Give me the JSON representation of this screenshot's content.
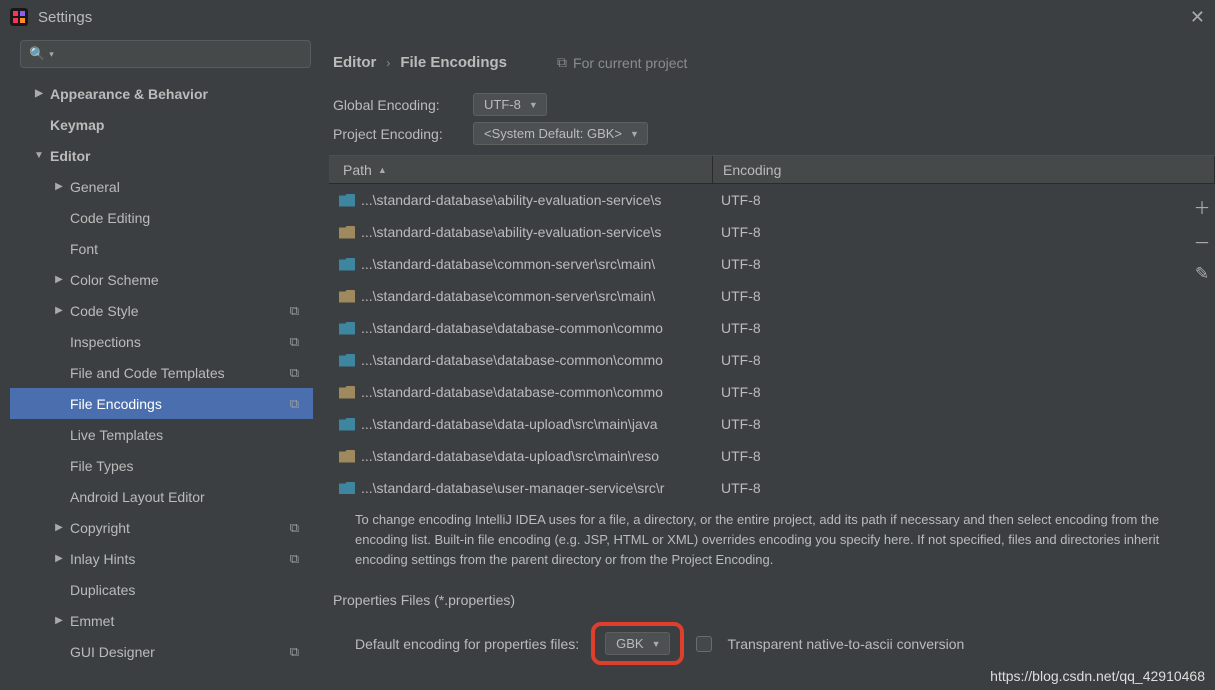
{
  "titlebar": {
    "title": "Settings"
  },
  "sidebar": {
    "items": [
      {
        "label": "Appearance & Behavior",
        "level": 1,
        "arrow": "▶",
        "bold": true
      },
      {
        "label": "Keymap",
        "level": 1,
        "arrow": "",
        "bold": true
      },
      {
        "label": "Editor",
        "level": 1,
        "arrow": "▼",
        "bold": true
      },
      {
        "label": "General",
        "level": 2,
        "arrow": "▶"
      },
      {
        "label": "Code Editing",
        "level": 2,
        "arrow": ""
      },
      {
        "label": "Font",
        "level": 2,
        "arrow": ""
      },
      {
        "label": "Color Scheme",
        "level": 2,
        "arrow": "▶"
      },
      {
        "label": "Code Style",
        "level": 2,
        "arrow": "▶",
        "copy": true
      },
      {
        "label": "Inspections",
        "level": 2,
        "arrow": "",
        "copy": true
      },
      {
        "label": "File and Code Templates",
        "level": 2,
        "arrow": "",
        "copy": true
      },
      {
        "label": "File Encodings",
        "level": 2,
        "arrow": "",
        "copy": true,
        "selected": true
      },
      {
        "label": "Live Templates",
        "level": 2,
        "arrow": ""
      },
      {
        "label": "File Types",
        "level": 2,
        "arrow": ""
      },
      {
        "label": "Android Layout Editor",
        "level": 2,
        "arrow": ""
      },
      {
        "label": "Copyright",
        "level": 2,
        "arrow": "▶",
        "copy": true
      },
      {
        "label": "Inlay Hints",
        "level": 2,
        "arrow": "▶",
        "copy": true
      },
      {
        "label": "Duplicates",
        "level": 2,
        "arrow": ""
      },
      {
        "label": "Emmet",
        "level": 2,
        "arrow": "▶"
      },
      {
        "label": "GUI Designer",
        "level": 2,
        "arrow": "",
        "copy": true
      }
    ]
  },
  "breadcrumb": {
    "b1": "Editor",
    "b2": "File Encodings",
    "proj": "For current project"
  },
  "globalEncoding": {
    "label": "Global Encoding:",
    "value": "UTF-8"
  },
  "projectEncoding": {
    "label": "Project Encoding:",
    "value": "<System Default: GBK>"
  },
  "table": {
    "header": {
      "path": "Path",
      "encoding": "Encoding"
    },
    "rows": [
      {
        "icon": "blue",
        "path": "...\\standard-database\\ability-evaluation-service\\s",
        "encoding": "UTF-8"
      },
      {
        "icon": "brown",
        "path": "...\\standard-database\\ability-evaluation-service\\s",
        "encoding": "UTF-8"
      },
      {
        "icon": "blue",
        "path": "...\\standard-database\\common-server\\src\\main\\",
        "encoding": "UTF-8"
      },
      {
        "icon": "brown",
        "path": "...\\standard-database\\common-server\\src\\main\\",
        "encoding": "UTF-8"
      },
      {
        "icon": "blue",
        "path": "...\\standard-database\\database-common\\commo",
        "encoding": "UTF-8"
      },
      {
        "icon": "blue",
        "path": "...\\standard-database\\database-common\\commo",
        "encoding": "UTF-8"
      },
      {
        "icon": "brown",
        "path": "...\\standard-database\\database-common\\commo",
        "encoding": "UTF-8"
      },
      {
        "icon": "blue",
        "path": "...\\standard-database\\data-upload\\src\\main\\java",
        "encoding": "UTF-8"
      },
      {
        "icon": "brown",
        "path": "...\\standard-database\\data-upload\\src\\main\\reso",
        "encoding": "UTF-8"
      },
      {
        "icon": "blue",
        "path": "...\\standard-database\\user-manager-service\\src\\r",
        "encoding": "UTF-8"
      }
    ]
  },
  "helptext": "To change encoding IntelliJ IDEA uses for a file, a directory, or the entire project, add its path if necessary and then select encoding from the encoding list. Built-in file encoding (e.g. JSP, HTML or XML) overrides encoding you specify here. If not specified, files and directories inherit encoding settings from the parent directory or from the Project Encoding.",
  "propertiesSection": {
    "title": "Properties Files (*.properties)",
    "defaultLabel": "Default encoding for properties files:",
    "defaultValue": "GBK",
    "transparentLabel": "Transparent native-to-ascii conversion"
  },
  "watermark": "https://blog.csdn.net/qq_42910468"
}
